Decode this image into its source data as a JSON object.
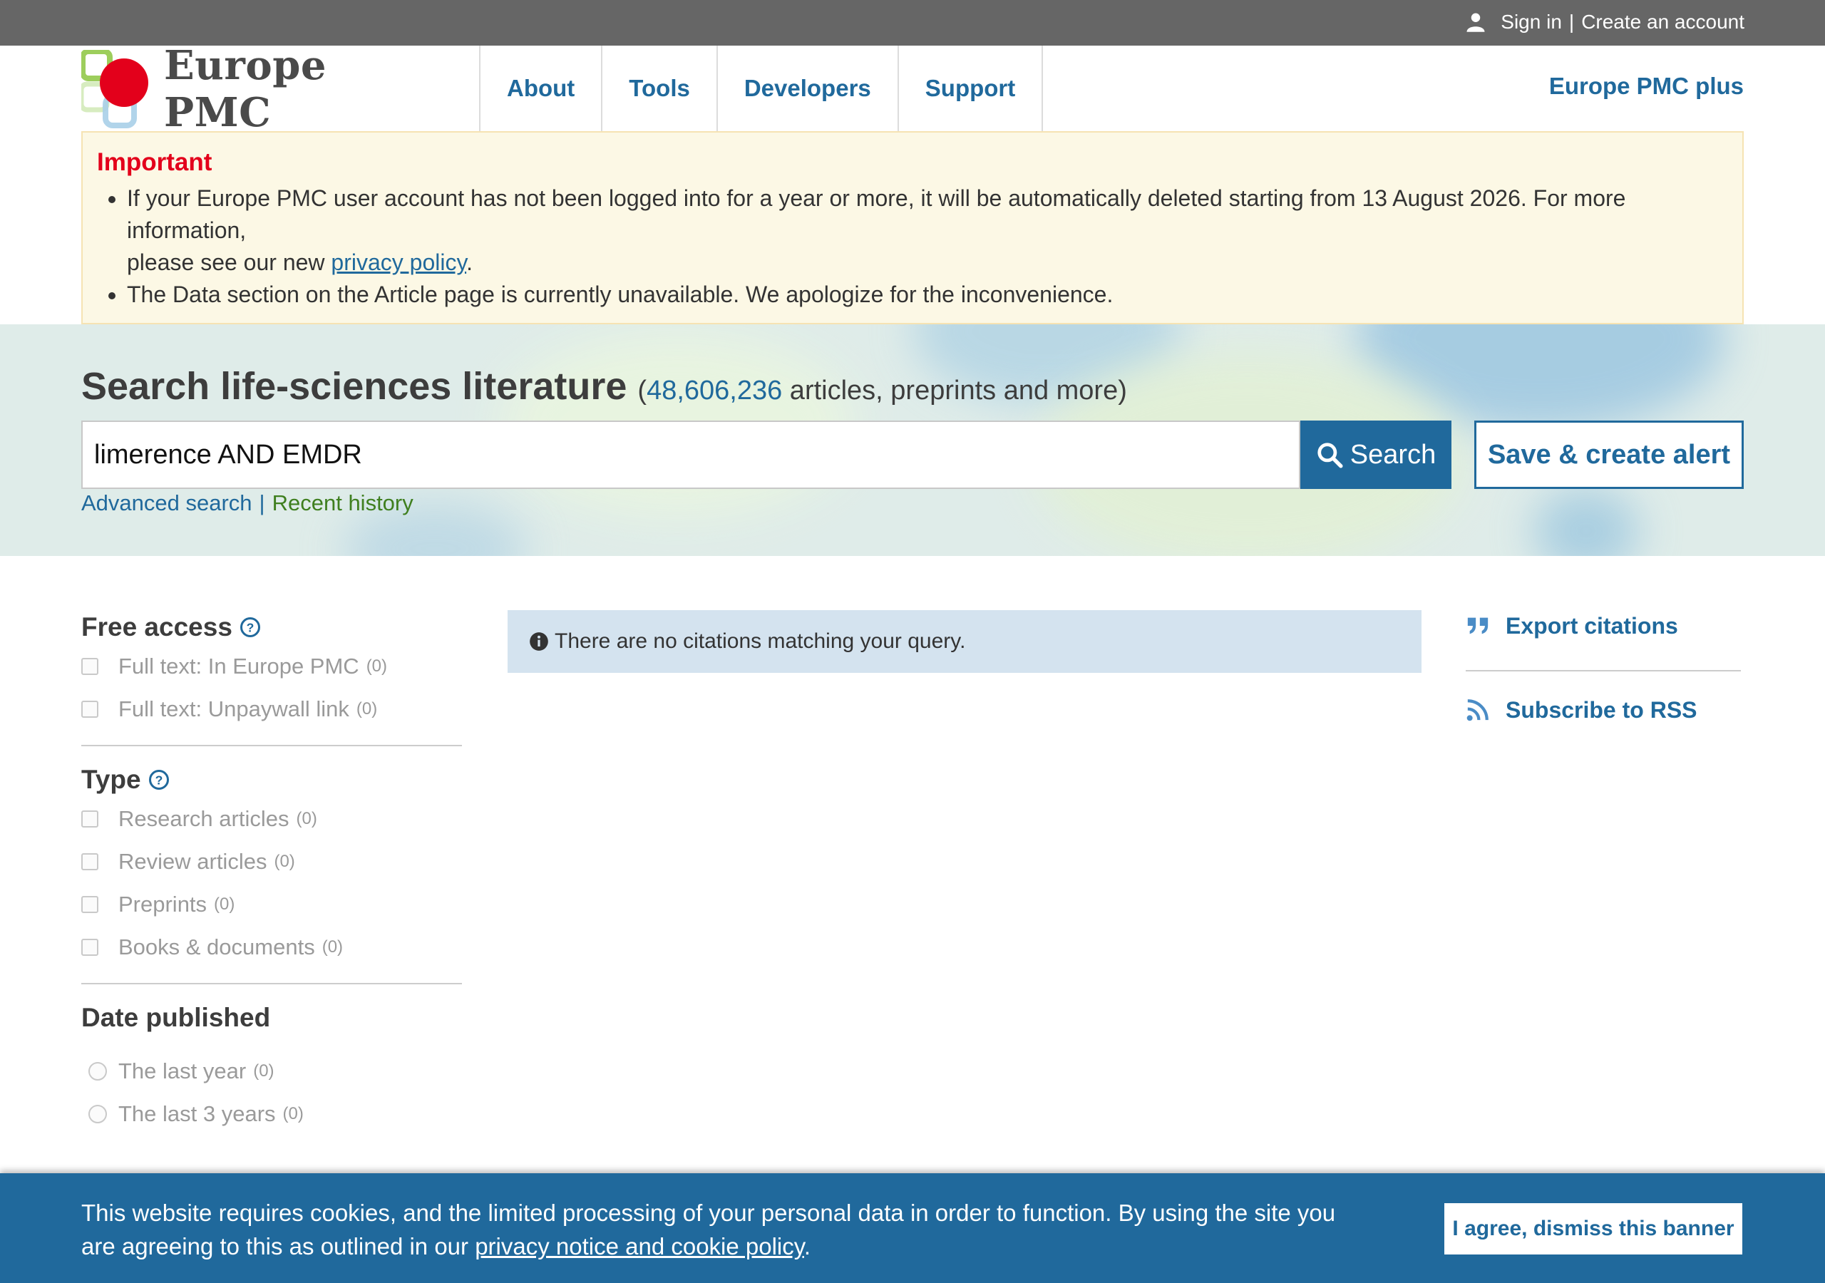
{
  "topbar": {
    "sign_in": "Sign in",
    "separator": "|",
    "create_account": "Create an account"
  },
  "header": {
    "logo_text": "Europe PMC",
    "nav": [
      "About",
      "Tools",
      "Developers",
      "Support"
    ],
    "plus": "Europe PMC plus"
  },
  "notice": {
    "heading": "Important",
    "item1_text": "If your Europe PMC user account has not been logged into for a year or more, it will be automatically deleted starting from 13 August 2026. For more information,",
    "item1_prefix": "please see our new ",
    "item1_link": "privacy policy",
    "item1_suffix": ".",
    "item2_text": "The Data section on the Article page is currently unavailable. We apologize for the inconvenience."
  },
  "search": {
    "title": "Search life-sciences literature",
    "count_open": "(",
    "count": "48,606,236",
    "count_rest": " articles, preprints and more)",
    "query": "limerence AND EMDR",
    "button": "Search",
    "alert_button": "Save & create alert",
    "advanced": "Advanced search",
    "separator": "|",
    "history": "Recent history"
  },
  "filters": {
    "free_access": {
      "title": "Free access",
      "options": [
        {
          "label": "Full text: In Europe PMC",
          "count": "(0)"
        },
        {
          "label": "Full text: Unpaywall link",
          "count": "(0)"
        }
      ]
    },
    "type": {
      "title": "Type",
      "options": [
        {
          "label": "Research articles",
          "count": "(0)"
        },
        {
          "label": "Review articles",
          "count": "(0)"
        },
        {
          "label": "Preprints",
          "count": "(0)"
        },
        {
          "label": "Books & documents",
          "count": "(0)"
        }
      ]
    },
    "date": {
      "title": "Date published",
      "options": [
        {
          "label": "The last year",
          "count": "(0)"
        },
        {
          "label": "The last 3 years",
          "count": "(0)"
        }
      ]
    }
  },
  "results": {
    "no_results": "There are no citations matching your query."
  },
  "actions": {
    "export": "Export citations",
    "rss": "Subscribe to RSS"
  },
  "cookie": {
    "text": "This website requires cookies, and the limited processing of your personal data in order to function. By using the site you are agreeing to this as outlined in our ",
    "link": "privacy notice and cookie policy",
    "suffix": ".",
    "agree": "I agree, dismiss this banner"
  },
  "colors": {
    "brand_blue": "#20699c",
    "important_red": "#e3001b",
    "history_green": "#3f7f1f",
    "topbar_gray": "#666666"
  }
}
